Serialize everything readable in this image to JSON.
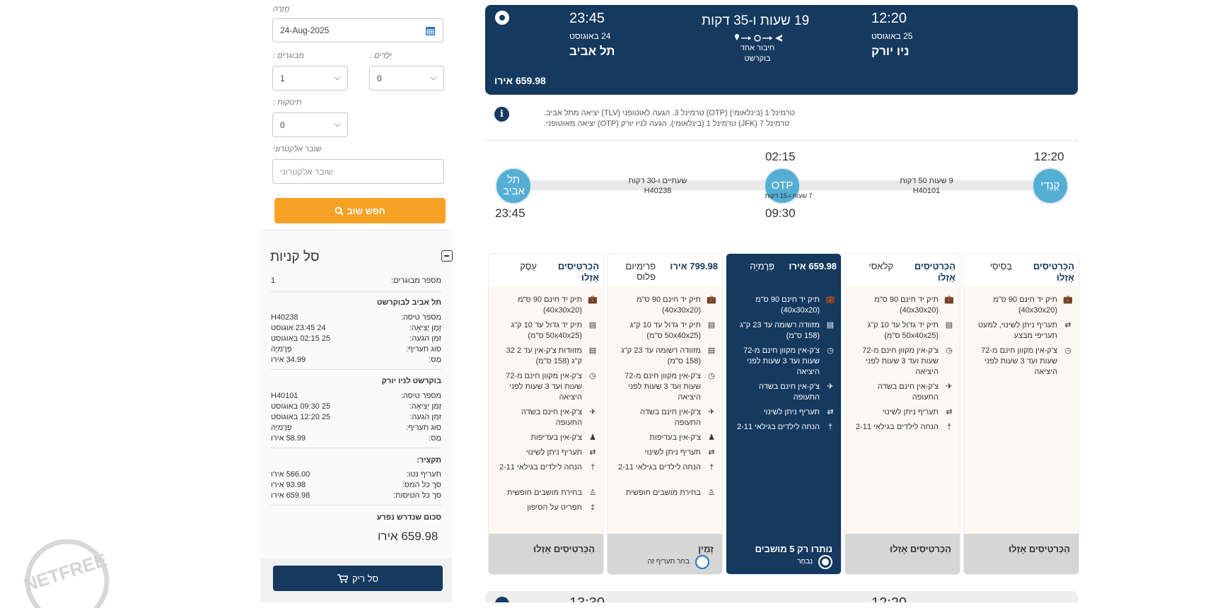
{
  "search_form": {
    "return_label": "חֲזָרָה",
    "return_date": "24-Aug-2025",
    "adults_label": "מבוגרים :",
    "adults_value": "1",
    "children_label": "יְלָדִים :",
    "children_value": "0",
    "infants_label": "תינוקות :",
    "infants_value": "0",
    "voucher_label": "שובר אלקטרוני",
    "voucher_placeholder": "שובר אלקטרוני",
    "search_button": "חפש שוב"
  },
  "cart": {
    "title": "סל קניות",
    "passengers_label": "מספר מבוגרים:",
    "passengers_value": "1",
    "leg1": {
      "title": "תל אביב לבוקרשט",
      "flight_label": "מספר טיסה:",
      "flight_value": "H40238",
      "dep_label": "זְמַן יְצִיאָה:",
      "dep_value": "24 23:45 אוגוסט",
      "arr_label": "זמן הגעה:",
      "arr_value": "25 02:15 באוגוסט",
      "fare_label": "סוג תעריף:",
      "fare_value": "פְּרֶמיָה",
      "tax_label": "מַס:",
      "tax_value": "34.99 אירו"
    },
    "leg2": {
      "title": "בוקרשט לניו יורק",
      "flight_label": "מספר טיסה:",
      "flight_value": "H40101",
      "dep_label": "זְמַן יְצִיאָה:",
      "dep_value": "25 09:30 באוגוסט",
      "arr_label": "זמן הגעה:",
      "arr_value": "25 12:20 באוגוסט",
      "fare_label": "סוג תעריף:",
      "fare_value": "פְּרֶמיָה",
      "tax_label": "מַס:",
      "tax_value": "58.99 אירו"
    },
    "summary": {
      "title": "תַקצִיר:",
      "net_label": "תעריף נטו:",
      "net_value": "566.00 אירו",
      "tax_label": "סך כל המס:",
      "tax_value": "93.98 אירו",
      "total_label": "סך כל הטיסות:",
      "total_value": "659.98 אירו"
    },
    "separate_title": "סכום שנדרש נפרע",
    "separate_value": "659.98 אירו",
    "empty_button": "סל ריק"
  },
  "flight": {
    "dep_time": "23:45",
    "dep_date": "24 באוגוסט",
    "dep_city": "תל אביב",
    "duration": "19 שעות ו-35 דקות",
    "connection": "חיבור אחד",
    "via": "בוקרשט",
    "arr_time": "12:20",
    "arr_date": "25 באוגוסט",
    "arr_city": "ניו יורק",
    "price": "659.98 אירו",
    "info_line1": "טרמינל 1 (בינלאומי) (OTP) טרמינל 3. הגעה לאוטופני (TLV) יציאה מתל אביב.",
    "info_line2": "טרמינל 7 (JFK) טרמינל 1 (בינלאומי). הגעה לניו יורק (OTP) יציאה מאוטופני."
  },
  "timeline": {
    "origin_code": "תל אביב",
    "stop_code": "OTP",
    "dest_code": "קֶנֶדִי",
    "origin_time": "23:45",
    "stop_arr": "02:15",
    "stop_dep": "09:30",
    "dest_time": "12:20",
    "seg1_duration": "שעתיים ו-30 דקות",
    "seg1_flight": "H40238",
    "layover": "7 שעות ו-15 דקות",
    "seg2_duration": "9 שעות 50 דקות",
    "seg2_flight": "H40101"
  },
  "fares": [
    {
      "name": "בְּסִיסִי",
      "price": "הַכַּרטִיסִים אָזְלוּ",
      "features": [
        "תיק יד חינם 90 ס\"מ (40x30x20)",
        "תעריף ניתן לשינוי, למעט תעריפי מבצע",
        "צ'ק-אין מקוון חינם מ-72 שעות ועד 3 שעות לפני היציאה"
      ],
      "footer": "הַכַּרטִיסִים אָזְלוּ"
    },
    {
      "name": "קלאסי",
      "price": "הַכַּרטִיסִים אָזְלוּ",
      "features": [
        "תיק יד חינם 90 ס\"מ (40x30x20)",
        "תיק יד גדול עד 10 ק\"ג (50x40x25 ס\"מ)",
        "צ'ק-אין מקוון חינם מ-72 שעות ועד 3 שעות לפני היציאה",
        "צ'ק-אין חינם בשדה התעופה",
        "תעריף ניתן לשינוי",
        "הנחה לילדים בגילאי 2-11"
      ],
      "footer": "הַכַּרטִיסִים אָזְלוּ"
    },
    {
      "name": "פְּרֶמיָה",
      "price": "659.98 אירו",
      "features": [
        "תיק יד חינם 90 ס\"מ (40x30x20)",
        "מזוודה רשומה עד 23 ק\"ג (158 ס\"מ)",
        "צ'ק-אין מקוון חינם מ-72 שעות ועד 3 שעות לפני היציאה",
        "צ'ק-אין חינם בשדה התעופה",
        "תעריף ניתן לשינוי",
        "הנחה לילדים בגילאי 2-11"
      ],
      "footer": "נותרו רק 5 מושבים",
      "radio_label": "נִבחָר"
    },
    {
      "name": "פרימיום פלוס",
      "price": "799.98 אירו",
      "features": [
        "תיק יד חינם 90 ס\"מ (40x30x20)",
        "תיק יד גדול עד 10 ק\"ג (50x40x25 ס\"מ)",
        "מזוודה רשומה עד 23 ק\"ג (158 ס\"מ)",
        "צ'ק-אין מקוון חינם מ-72 שעות ועד 3 שעות לפני היציאה",
        "צ'ק-אין חינם בשדה התעופה",
        "צ'ק-אין בעדיפות",
        "תעריף ניתן לשינוי",
        "הנחה לילדים בגילאי 2-11",
        "בחירת מושבים חופשית"
      ],
      "footer": "זָמִין",
      "radio_label": "בחר תעריף זה"
    },
    {
      "name": "עֵסֶק",
      "price": "הַכַּרטִיסִים אָזְלוּ",
      "features": [
        "תיק יד חינם 90 ס\"מ (40x30x20)",
        "תיק יד גדול עד 10 ק\"ג (50x40x25 ס\"מ)",
        "מזוודות צ'ק-אין עד 2 32 ק\"ג (158 ס\"מ)",
        "צ'ק-אין מקוון חינם מ-72 שעות ועד 3 שעות לפני היציאה",
        "צ'ק-אין חינם בשדה התעופה",
        "צ'ק-אין בעדיפות",
        "תעריף ניתן לשינוי",
        "הנחה לילדים בגילאי 2-11",
        "בחירת מושבים חופשית",
        "תפריט על הסיפון"
      ],
      "footer": "הַכַּרטִיסִים אָזְלוּ"
    }
  ],
  "next_flight": {
    "dep_time": "13:30",
    "arr_time": "12:20"
  },
  "watermark": "NETFREE",
  "colors": {
    "navy": "#15395f",
    "orange": "#f6a224",
    "node": "#55aed4"
  }
}
